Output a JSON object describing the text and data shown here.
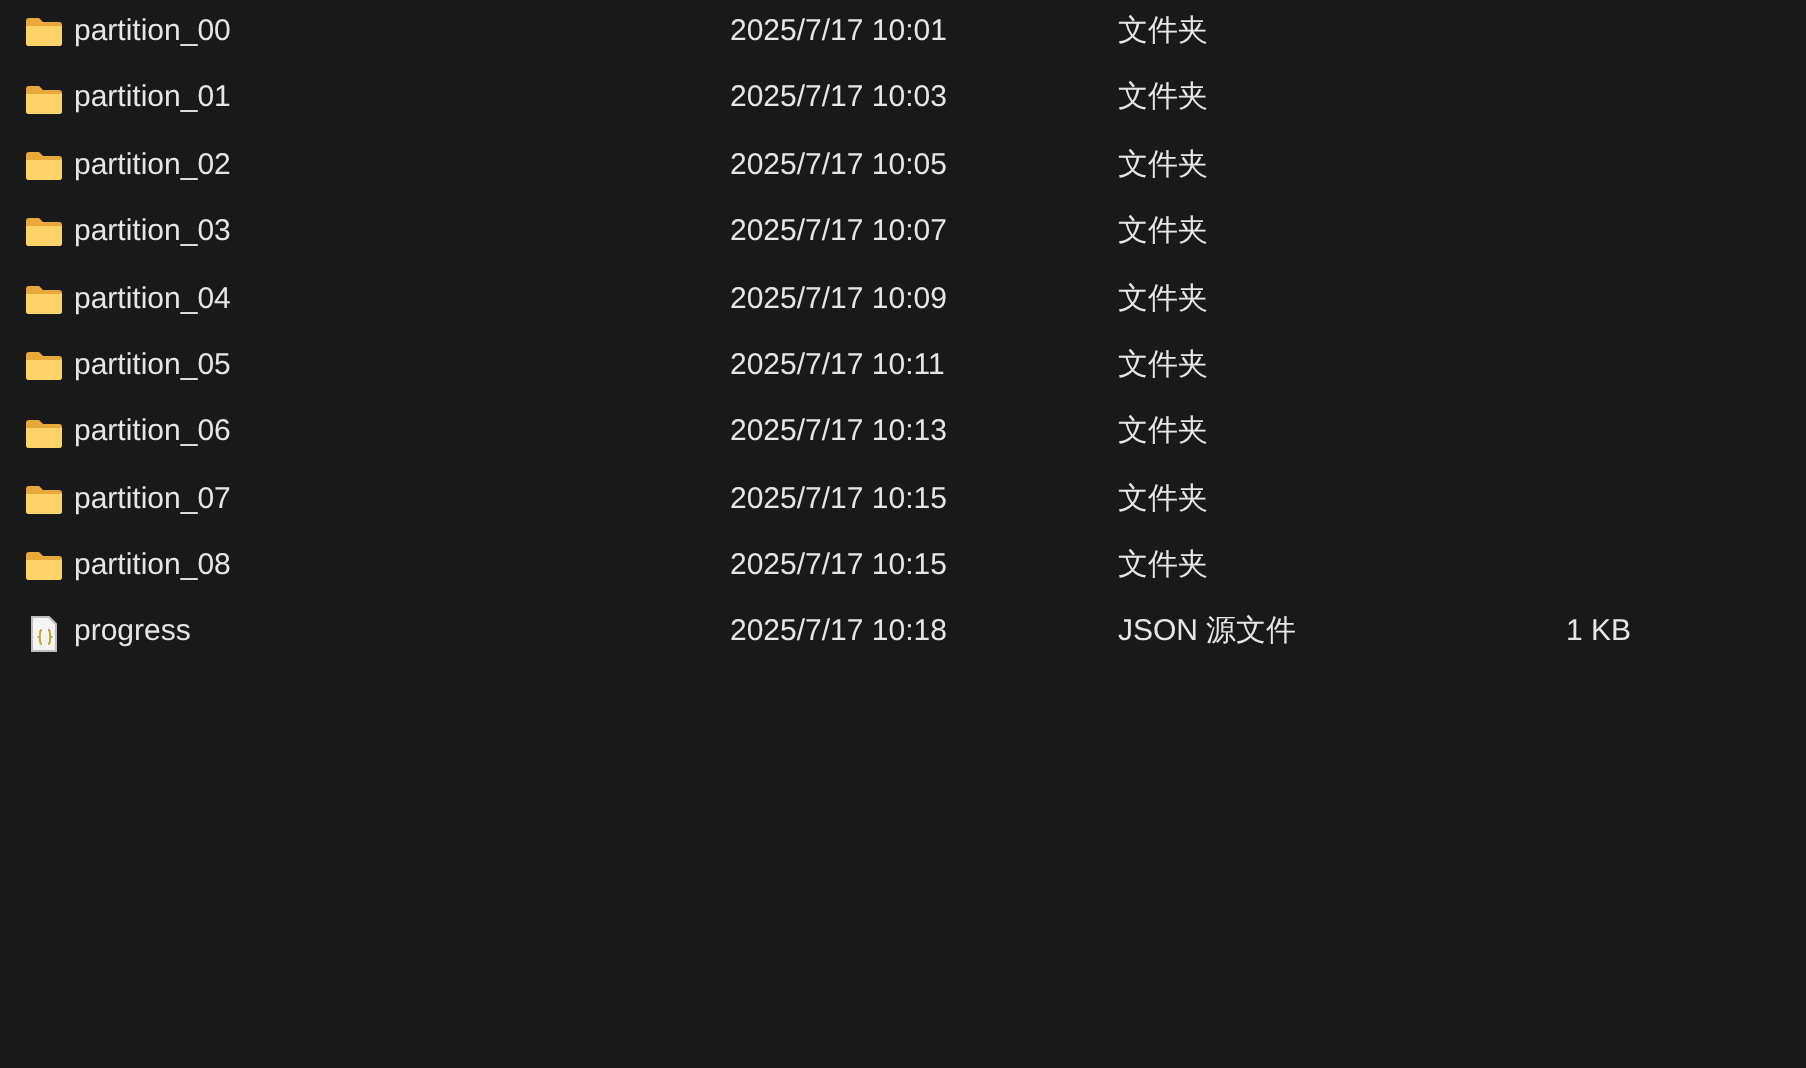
{
  "files": [
    {
      "kind": "folder",
      "name": "partition_00",
      "modified": "2025/7/17 10:01",
      "type": "文件夹"
    },
    {
      "kind": "folder",
      "name": "partition_01",
      "modified": "2025/7/17 10:03",
      "type": "文件夹"
    },
    {
      "kind": "folder",
      "name": "partition_02",
      "modified": "2025/7/17 10:05",
      "type": "文件夹"
    },
    {
      "kind": "folder",
      "name": "partition_03",
      "modified": "2025/7/17 10:07",
      "type": "文件夹"
    },
    {
      "kind": "folder",
      "name": "partition_04",
      "modified": "2025/7/17 10:09",
      "type": "文件夹"
    },
    {
      "kind": "folder",
      "name": "partition_05",
      "modified": "2025/7/17 10:11",
      "type": "文件夹"
    },
    {
      "kind": "folder",
      "name": "partition_06",
      "modified": "2025/7/17 10:13",
      "type": "文件夹"
    },
    {
      "kind": "folder",
      "name": "partition_07",
      "modified": "2025/7/17 10:15",
      "type": "文件夹"
    },
    {
      "kind": "folder",
      "name": "partition_08",
      "modified": "2025/7/17 10:15",
      "type": "文件夹"
    },
    {
      "kind": "json",
      "name": "progress",
      "modified": "2025/7/17 10:18",
      "type": "JSON 源文件",
      "size": "1 KB"
    }
  ]
}
